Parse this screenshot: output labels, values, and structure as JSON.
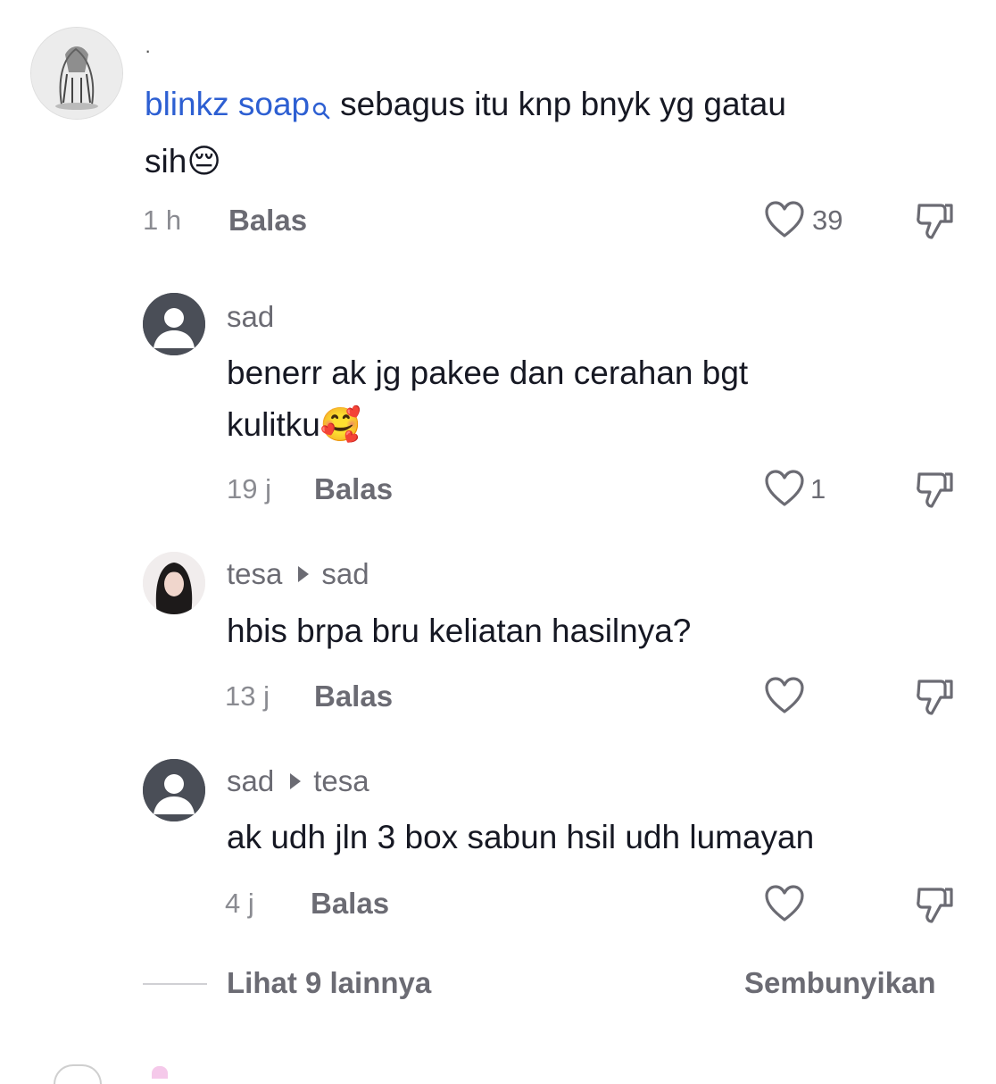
{
  "comments": [
    {
      "author": "blinkz soap",
      "badge": "·",
      "text": "sebagus itu knp bnyk yg gatau sih",
      "line1": "sebagus itu knp bnyk yg gatau",
      "line2": "sih",
      "emoji": "😔",
      "time": "1 h",
      "reply_label": "Balas",
      "likes": "39"
    }
  ],
  "replies": [
    {
      "author": "sad",
      "line1": "benerr ak jg pakee dan cerahan bgt",
      "line2": "kulitku",
      "emoji": "🥰",
      "time": "19 j",
      "reply_label": "Balas",
      "likes": "1"
    },
    {
      "author": "tesa",
      "reply_to": "sad",
      "text": "hbis brpa bru keliatan hasilnya?",
      "time": "13 j",
      "reply_label": "Balas",
      "likes": ""
    },
    {
      "author": "sad",
      "reply_to": "tesa",
      "text": "ak udh jln 3 box sabun hsil udh lumayan",
      "time": "4 j",
      "reply_label": "Balas",
      "likes": ""
    }
  ],
  "footer": {
    "more_label": "Lihat 9 lainnya",
    "hide_label": "Sembunyikan"
  },
  "icons": {
    "like": "heart-outline-icon",
    "dislike": "thumbs-down-icon",
    "search": "search-icon",
    "reply_arrow": "triangle-right-icon"
  },
  "colors": {
    "mention": "#2d5fd2",
    "text": "#161823",
    "muted": "#6b6b73"
  }
}
